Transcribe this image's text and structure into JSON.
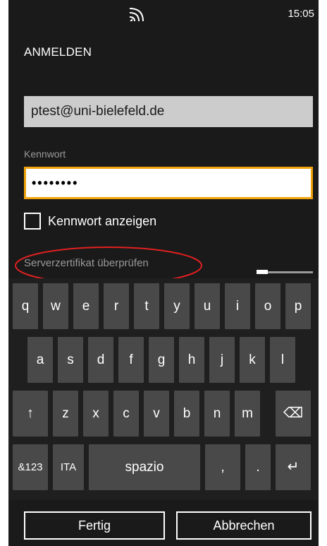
{
  "status_bar": {
    "time": "15:05",
    "signal_icon": "wifi-signal-icon"
  },
  "page": {
    "title": "ANMELDEN"
  },
  "form": {
    "email_value": "ptest@uni-bielefeld.de",
    "password_label": "Kennwort",
    "password_value": "••••••••",
    "show_password_label": "Kennwort anzeigen",
    "show_password_checked": false,
    "server_cert_label": "Serverzertifikat überprüfen"
  },
  "keyboard": {
    "row1": [
      "q",
      "w",
      "e",
      "r",
      "t",
      "y",
      "u",
      "i",
      "o",
      "p"
    ],
    "row2": [
      "a",
      "s",
      "d",
      "f",
      "g",
      "h",
      "j",
      "k",
      "l"
    ],
    "row3": [
      "z",
      "x",
      "c",
      "v",
      "b",
      "n",
      "m"
    ],
    "shift_key": "↑",
    "backspace_key": "⌫",
    "numbers_key": "&123",
    "language_key": "ITA",
    "space_key": "spazio",
    "comma_key": ",",
    "period_key": ".",
    "enter_key": "↵"
  },
  "actions": {
    "done_label": "Fertig",
    "cancel_label": "Abbrechen"
  },
  "colors": {
    "accent": "#f0a30a",
    "annotation": "#e02020",
    "background": "#1a1a1a",
    "key": "#494949"
  }
}
